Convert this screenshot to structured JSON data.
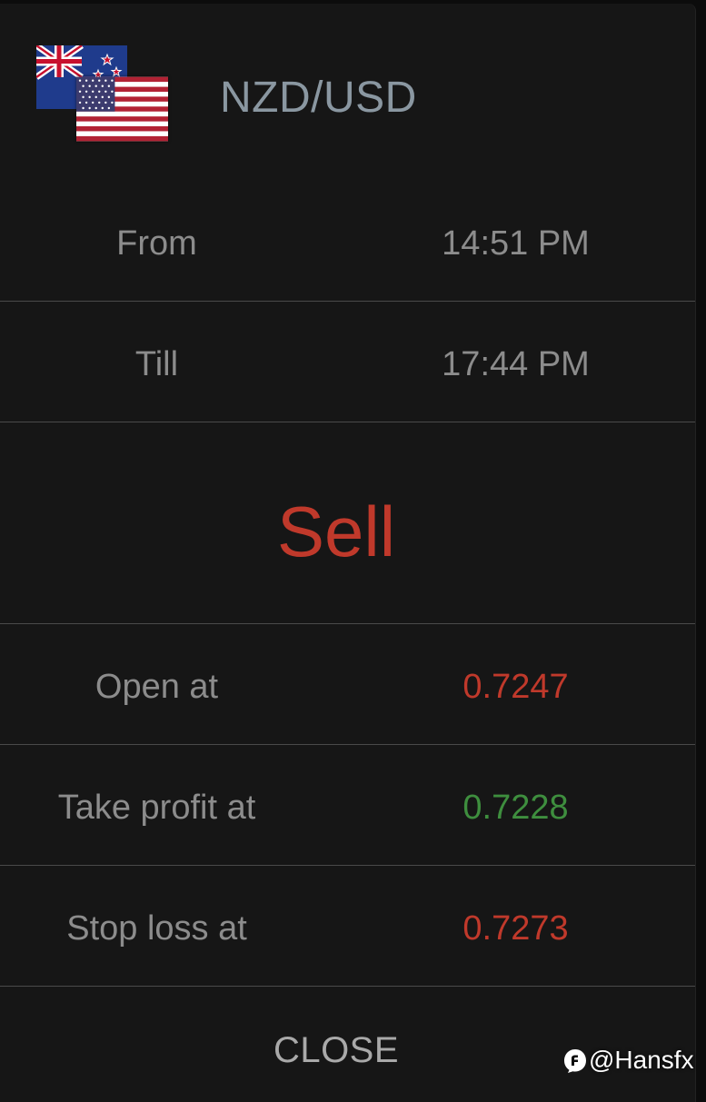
{
  "header": {
    "pair": "NZD/USD",
    "base_flag_icon": "new-zealand-flag-icon",
    "quote_flag_icon": "us-flag-icon"
  },
  "timing": {
    "from_label": "From",
    "from_value": "14:51 PM",
    "till_label": "Till",
    "till_value": "17:44 PM"
  },
  "signal": {
    "action": "Sell",
    "color": "#c0392b"
  },
  "levels": {
    "open_label": "Open at",
    "open_value": "0.7247",
    "take_profit_label": "Take profit at",
    "take_profit_value": "0.7228",
    "stop_loss_label": "Stop loss at",
    "stop_loss_value": "0.7273"
  },
  "colors": {
    "negative": "#c0392b",
    "positive": "#3e8e3e"
  },
  "footer": {
    "close_label": "CLOSE"
  },
  "watermark": {
    "text": "@Hansfx"
  }
}
